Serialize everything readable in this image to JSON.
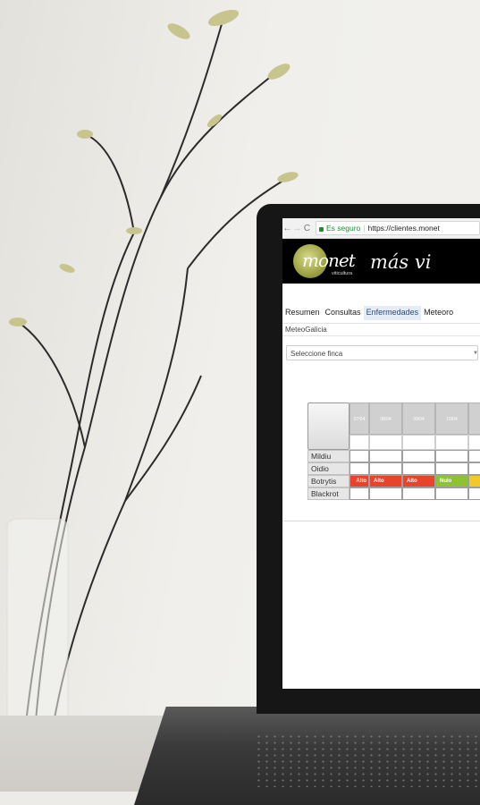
{
  "browser": {
    "secure_label": "Es seguro",
    "url": "https://clientes.monet",
    "back_glyph": "←",
    "forward_glyph": "→",
    "reload_glyph": "C"
  },
  "header": {
    "logo_text": "monet",
    "logo_sub": "viticultura",
    "tagline": "más vi"
  },
  "menu": {
    "items": [
      "Resumen",
      "Consultas",
      "Enfermedades",
      "Meteoro"
    ],
    "active": "Enfermedades"
  },
  "subbar": {
    "label": "MeteoGalicia"
  },
  "select": {
    "value": "Seleccione finca"
  },
  "table": {
    "dates": [
      "07/04",
      "08/04",
      "09/04",
      "10/04",
      ""
    ],
    "diseases": [
      "Mildiu",
      "Oidio",
      "Botrytis",
      "Blackrot"
    ],
    "botrytis_values": [
      "Alto",
      "Alto",
      "Alto",
      "Nulo",
      ""
    ]
  },
  "colors": {
    "alto": "#e8432b",
    "nulo": "#8fc232",
    "bajo": "#f2c928"
  }
}
